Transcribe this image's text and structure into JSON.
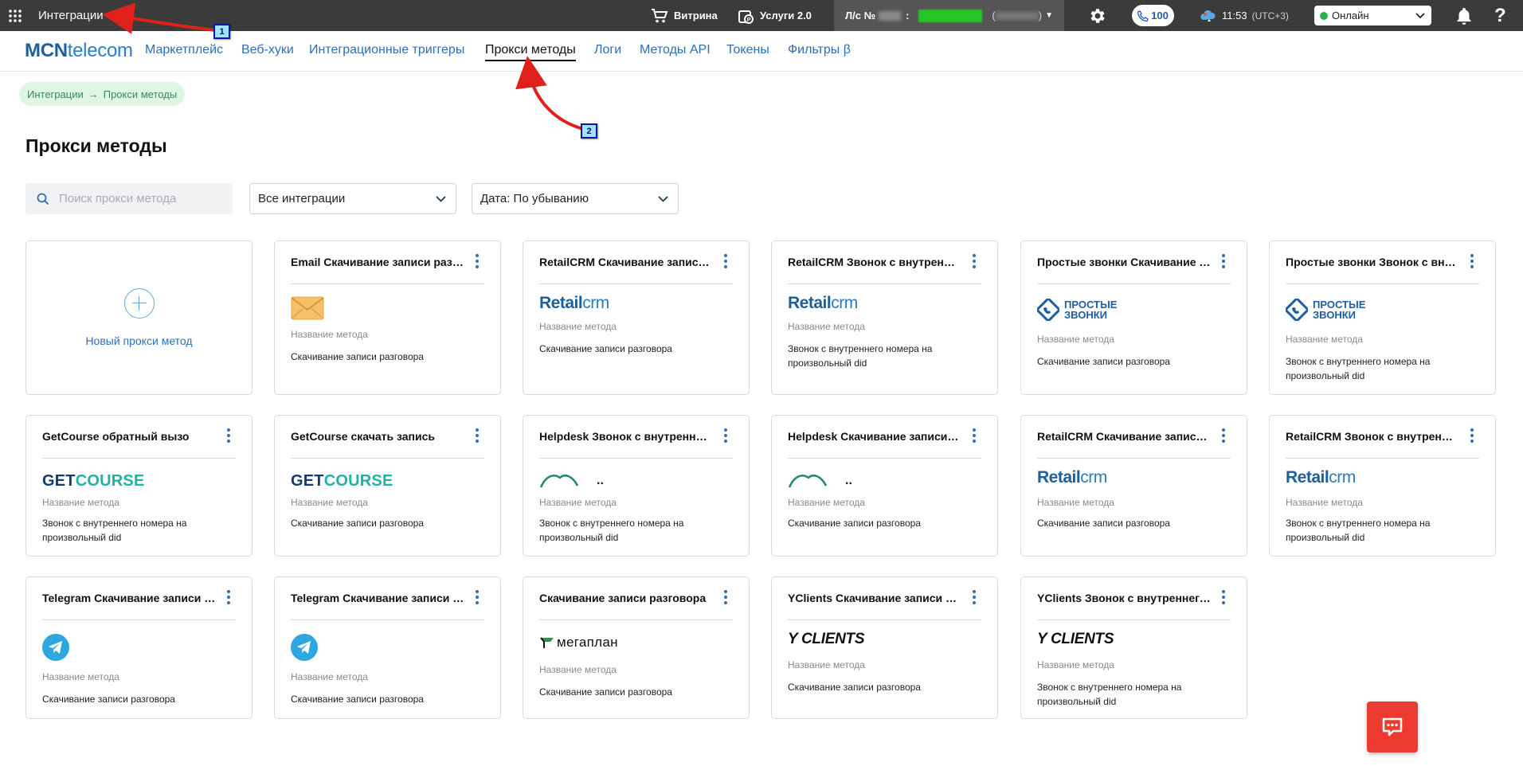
{
  "topbar": {
    "title": "Интеграции",
    "vitrina": "Витрина",
    "services": "Услуги 2.0",
    "account_label": "Л/с №",
    "account_colon": ":",
    "account_paren_open": "(",
    "account_paren_close": ")",
    "calls_count": "100",
    "time": "11:53",
    "timezone": "(UTC+3)",
    "status_value": "Онлайн",
    "help": "?",
    "colors": {
      "bar": "#3b3b3b",
      "status_dot": "#2bb24c"
    }
  },
  "nav": {
    "logo_bold": "MCN",
    "logo_light": "telecom",
    "links": [
      {
        "label": "Маркетплейс"
      },
      {
        "label": "Веб-хуки"
      },
      {
        "label": "Интеграционные триггеры"
      },
      {
        "label": "Прокси методы"
      },
      {
        "label": "Логи"
      },
      {
        "label": "Методы API"
      },
      {
        "label": "Токены"
      },
      {
        "label": "Фильтры β"
      }
    ],
    "active": "Прокси методы"
  },
  "breadcrumb": {
    "parent": "Интеграции",
    "arrow": "→",
    "current": "Прокси методы"
  },
  "page": {
    "title": "Прокси методы"
  },
  "filters": {
    "search_placeholder": "Поиск прокси метода",
    "integration_select": "Все интеграции",
    "sort_select": "Дата: По убыванию"
  },
  "new_card": {
    "label": "Новый прокси метод"
  },
  "field_label": "Название метода",
  "cards": [
    {
      "title": "Email Скачивание записи разговора",
      "logo": "email",
      "value": "Скачивание записи разговора"
    },
    {
      "title": "RetailCRM Скачивание записи разговора",
      "logo": "retailcrm",
      "value": "Скачивание записи разговора"
    },
    {
      "title": "RetailCRM Звонок с внутреннего номера",
      "logo": "retailcrm",
      "value": "Звонок с внутреннего номера на произвольный did"
    },
    {
      "title": "Простые звонки Скачивание записи",
      "logo": "prostye",
      "value": "Скачивание записи разговора"
    },
    {
      "title": "Простые звонки Звонок с внутреннего",
      "logo": "prostye",
      "value": "Звонок с внутреннего номера на произвольный did"
    },
    {
      "title": "GetCourse обратный вызо",
      "logo": "getcourse",
      "value": "Звонок с внутреннего номера на произвольный did"
    },
    {
      "title": "GetCourse скачать запись",
      "logo": "getcourse",
      "value": "Скачивание записи разговора"
    },
    {
      "title": "Helpdesk Звонок с внутреннего номера",
      "logo": "helpdesk",
      "value": "Звонок с внутреннего номера на произвольный did"
    },
    {
      "title": "Helpdesk Скачивание записи разговора",
      "logo": "helpdesk",
      "value": "Скачивание записи разговора"
    },
    {
      "title": "RetailCRM Скачивание записи разговора",
      "logo": "retailcrm",
      "value": "Скачивание записи разговора"
    },
    {
      "title": "RetailCRM Звонок с внутреннего номера",
      "logo": "retailcrm",
      "value": "Звонок с внутреннего номера на произвольный did"
    },
    {
      "title": "Telegram Скачивание записи разговора",
      "logo": "telegram",
      "value": "Скачивание записи разговора"
    },
    {
      "title": "Telegram Скачивание записи разговора",
      "logo": "telegram",
      "value": "Скачивание записи разговора"
    },
    {
      "title": "Скачивание записи разговора",
      "logo": "megaplan",
      "value": "Скачивание записи разговора"
    },
    {
      "title": "YClients Скачивание записи разговора",
      "logo": "yclients",
      "value": "Скачивание записи разговора"
    },
    {
      "title": "YClients Звонок с внутреннего номера",
      "logo": "yclients",
      "value": "Звонок с внутреннего номера на произвольный did"
    }
  ],
  "logos": {
    "retail_r": "R",
    "retail_etail": "etail",
    "retail_crm": "crm",
    "prostye_line1": "ПРОСТЫЕ",
    "prostye_line2": "ЗВОНКИ",
    "getcourse_get": "GET",
    "getcourse_course": "COURSE",
    "yclients": "Y CLIENTS",
    "megaplan": "мегаплан",
    "helpdesk_dots": ".."
  },
  "annotations": [
    {
      "label": "1"
    },
    {
      "label": "2"
    }
  ],
  "colors": {
    "accent": "#2d6fb5",
    "fab": "#ee3b32",
    "annotation_arrow": "#e0201a"
  }
}
